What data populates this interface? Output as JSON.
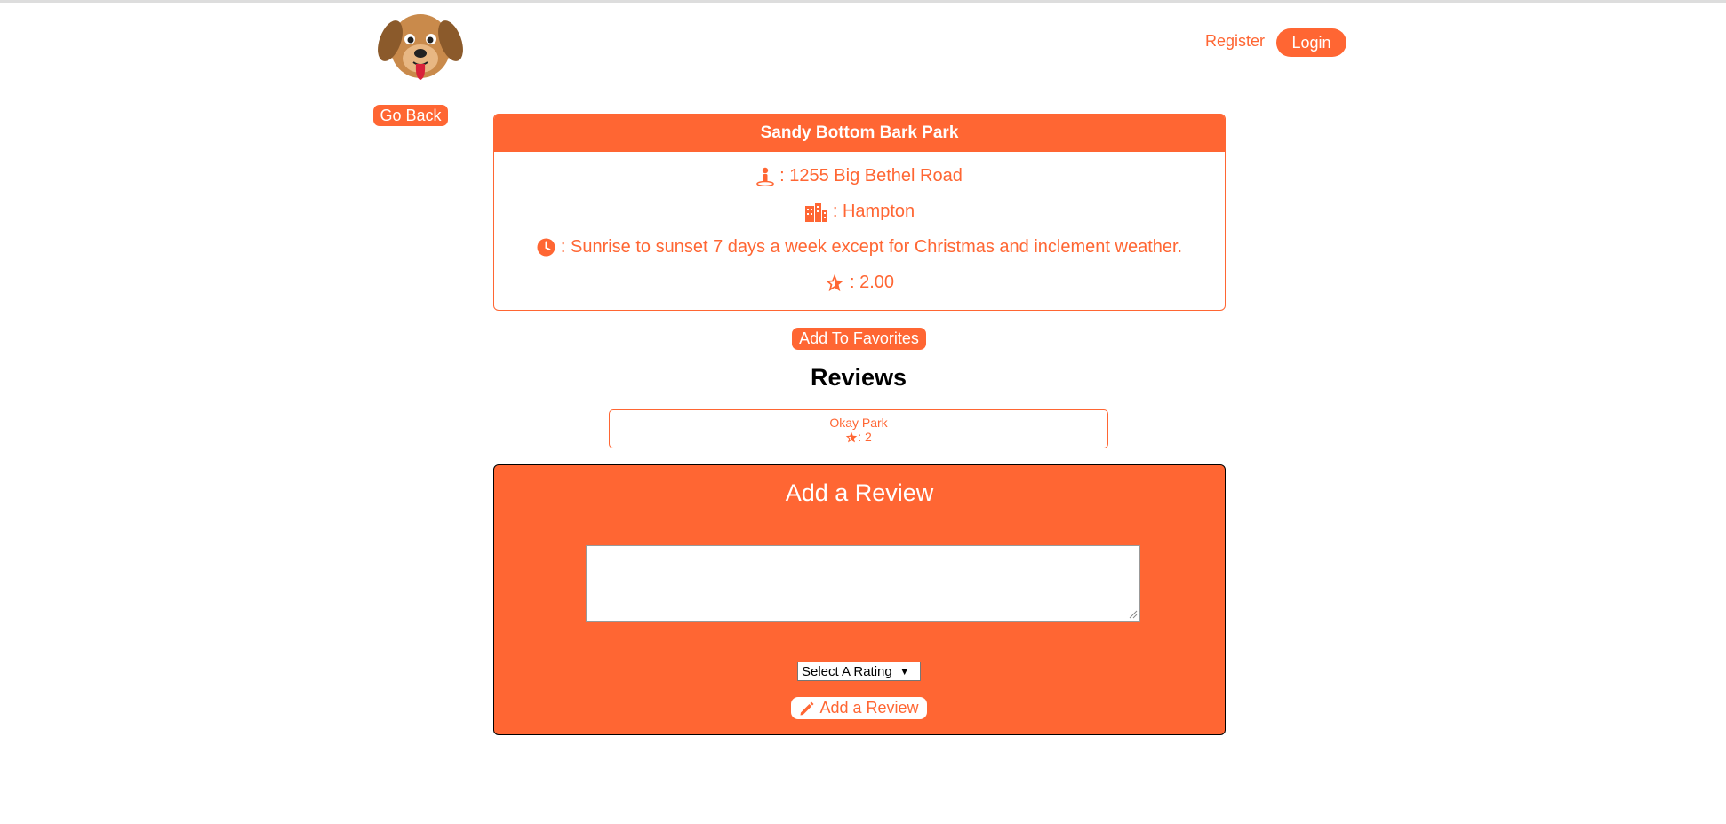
{
  "colors": {
    "accent": "#ff6633",
    "white": "#ffffff",
    "heading": "#000000"
  },
  "nav": {
    "register": "Register",
    "login": "Login"
  },
  "go_back": "Go Back",
  "park": {
    "name": "Sandy Bottom Bark Park",
    "address": ": 1255 Big Bethel Road",
    "city": ": Hampton",
    "hours": ": Sunrise to sunset 7 days a week except for Christmas and inclement weather.",
    "rating": ": 2.00",
    "icons": {
      "address": "location-pin-icon",
      "city": "city-icon",
      "hours": "clock-icon",
      "rating": "star-icon"
    }
  },
  "add_to_favorites": "Add To Favorites",
  "reviews": {
    "title": "Reviews",
    "items": [
      {
        "title": "Okay Park",
        "rating": ": 2"
      }
    ]
  },
  "add_review": {
    "title": "Add a Review",
    "textarea_value": "",
    "select_label": "Select A Rating",
    "submit_label": "Add a Review",
    "submit_icon": "pencil-icon"
  }
}
